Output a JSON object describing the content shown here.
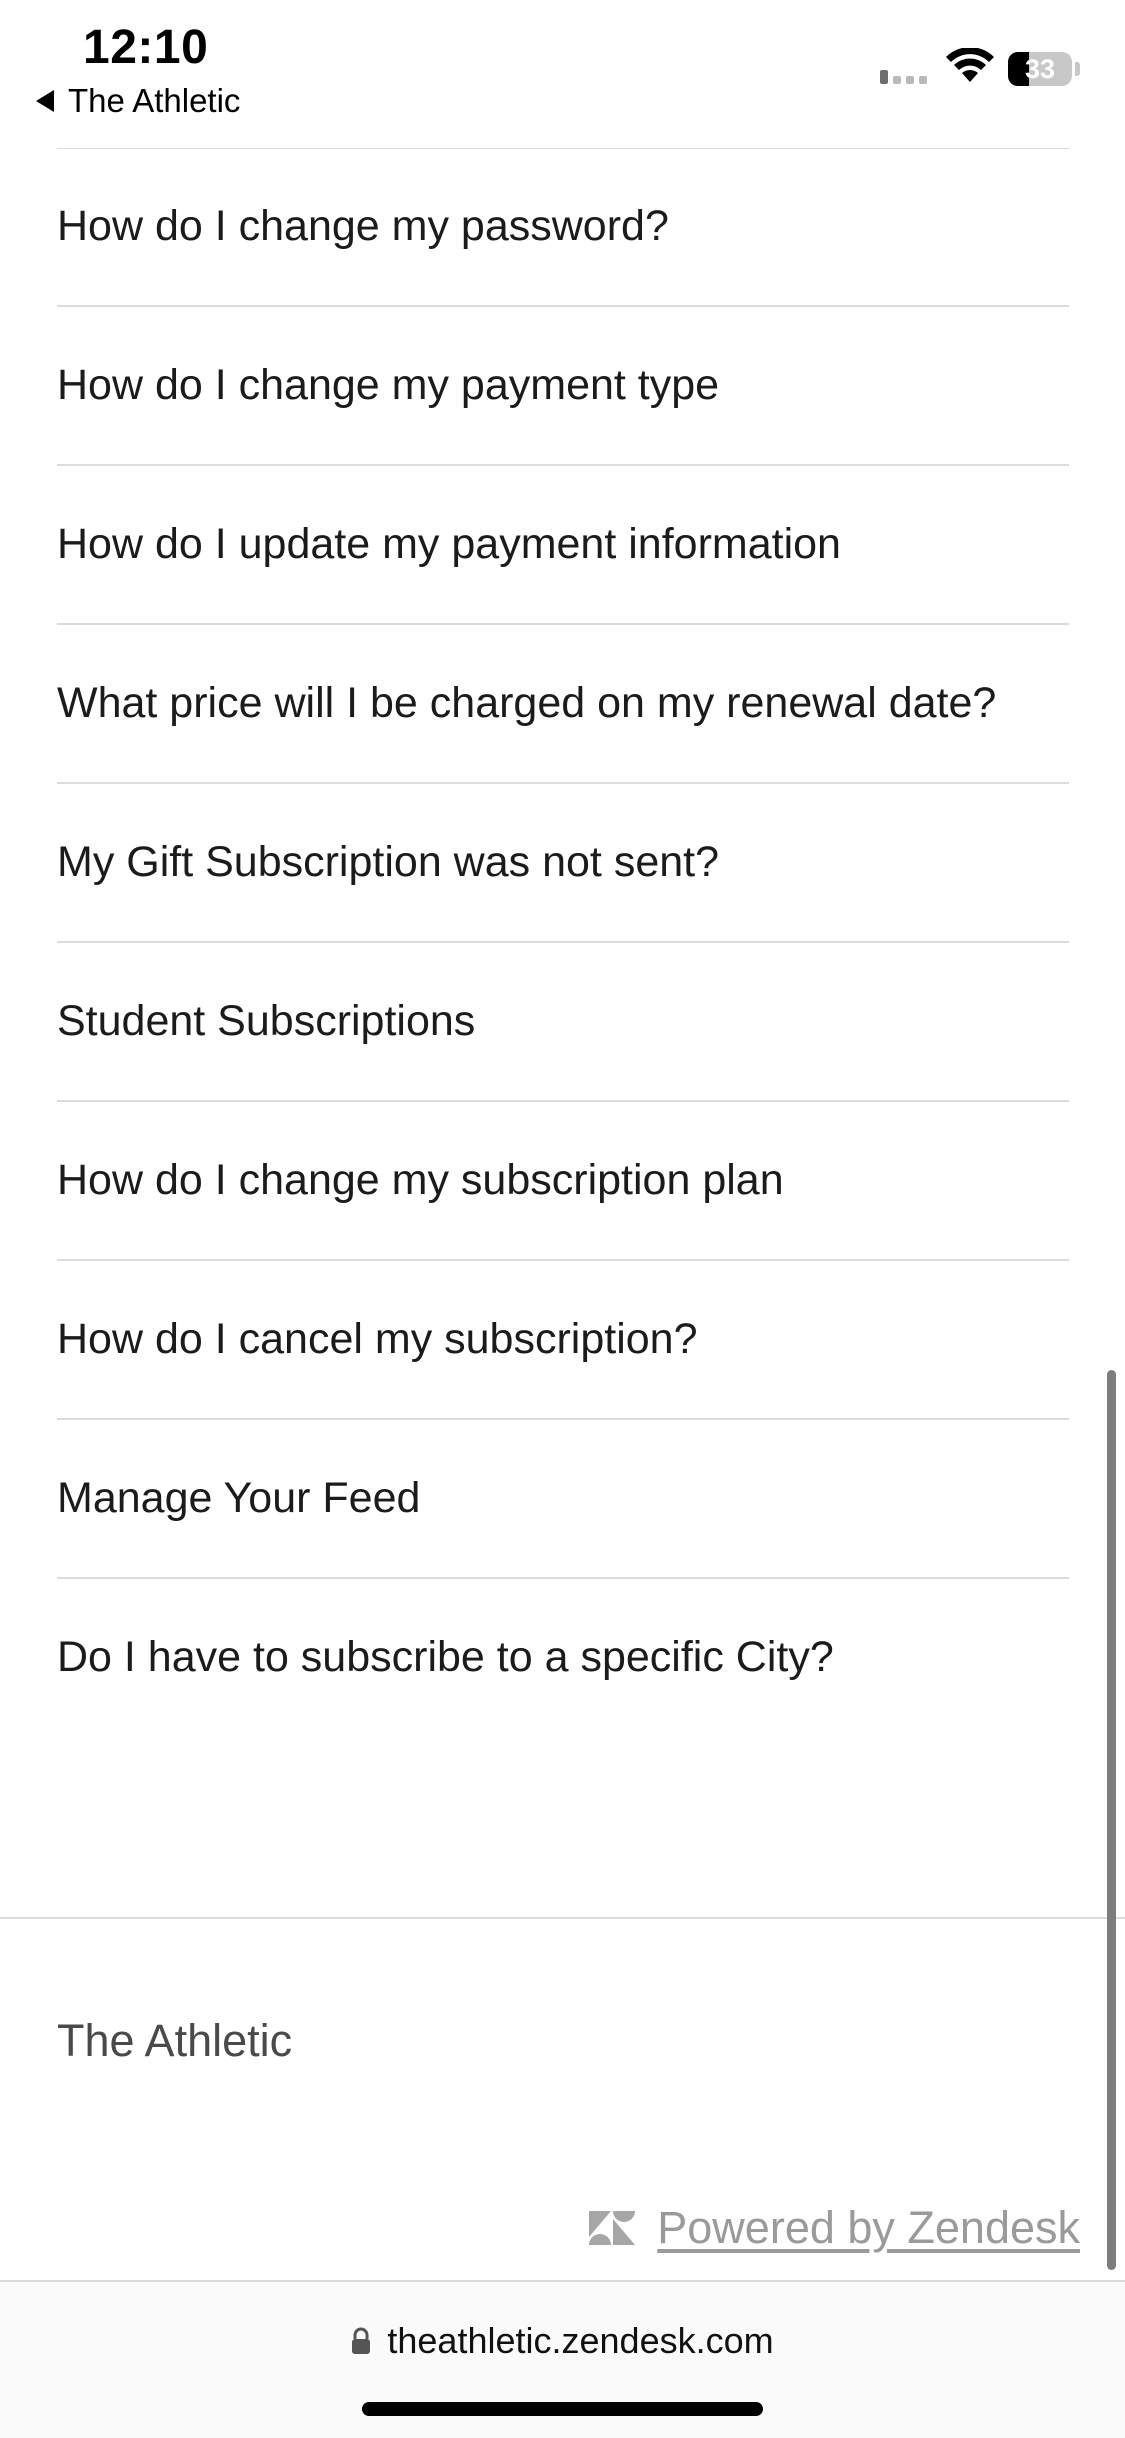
{
  "status_bar": {
    "time": "12:10",
    "back_app": "The Athletic",
    "battery": "33"
  },
  "articles": [
    "How do I change my password?",
    "How do I change my payment type",
    "How do I update my payment information",
    "What price will I be charged on my renewal date?",
    "My Gift Subscription was not sent?",
    "Student Subscriptions",
    "How do I change my subscription plan",
    "How do I cancel my subscription?",
    "Manage Your Feed",
    "Do I have to subscribe to a specific City?"
  ],
  "footer": {
    "brand": "The Athletic",
    "powered_by": "Powered by Zendesk"
  },
  "browser": {
    "url": "theathletic.zendesk.com"
  },
  "icons": {
    "back": "back-triangle-icon",
    "signal": "cellular-signal-icon",
    "wifi": "wifi-icon",
    "battery": "battery-icon",
    "zendesk": "zendesk-logo-icon",
    "lock": "lock-icon"
  },
  "colors": {
    "divider": "#dcdcdc",
    "text": "#1b1b1b",
    "muted": "#9a9a9a"
  }
}
